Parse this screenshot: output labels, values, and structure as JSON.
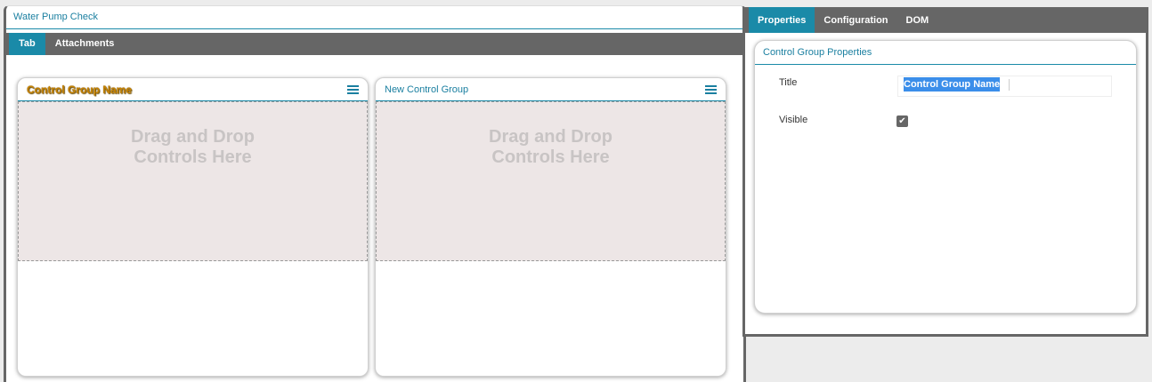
{
  "form": {
    "title": "Water Pump Check",
    "tabs": [
      {
        "label": "Tab",
        "active": true
      },
      {
        "label": "Attachments",
        "active": false
      }
    ],
    "groups": [
      {
        "title": "Control Group Name",
        "drop_text_line1": "Drag and Drop",
        "drop_text_line2": "Controls Here",
        "menu_icon": "hamburger-menu-icon"
      },
      {
        "title": "New Control Group",
        "drop_text_line1": "Drag and Drop",
        "drop_text_line2": "Controls Here",
        "menu_icon": "hamburger-menu-icon"
      }
    ]
  },
  "properties_panel": {
    "tabs": [
      {
        "label": "Properties",
        "active": true
      },
      {
        "label": "Configuration",
        "active": false
      },
      {
        "label": "DOM",
        "active": false
      }
    ],
    "section_title": "Control Group Properties",
    "fields": {
      "title_label": "Title",
      "title_value": "Control Group Name",
      "visible_label": "Visible",
      "visible_checked": true,
      "checkmark_glyph": "✔"
    }
  },
  "colors": {
    "accent": "#1a8aa8",
    "tab_bar": "#666666",
    "drop_zone": "#ede6e6",
    "selected_title": "#c88400",
    "selection": "#3b8eea"
  }
}
